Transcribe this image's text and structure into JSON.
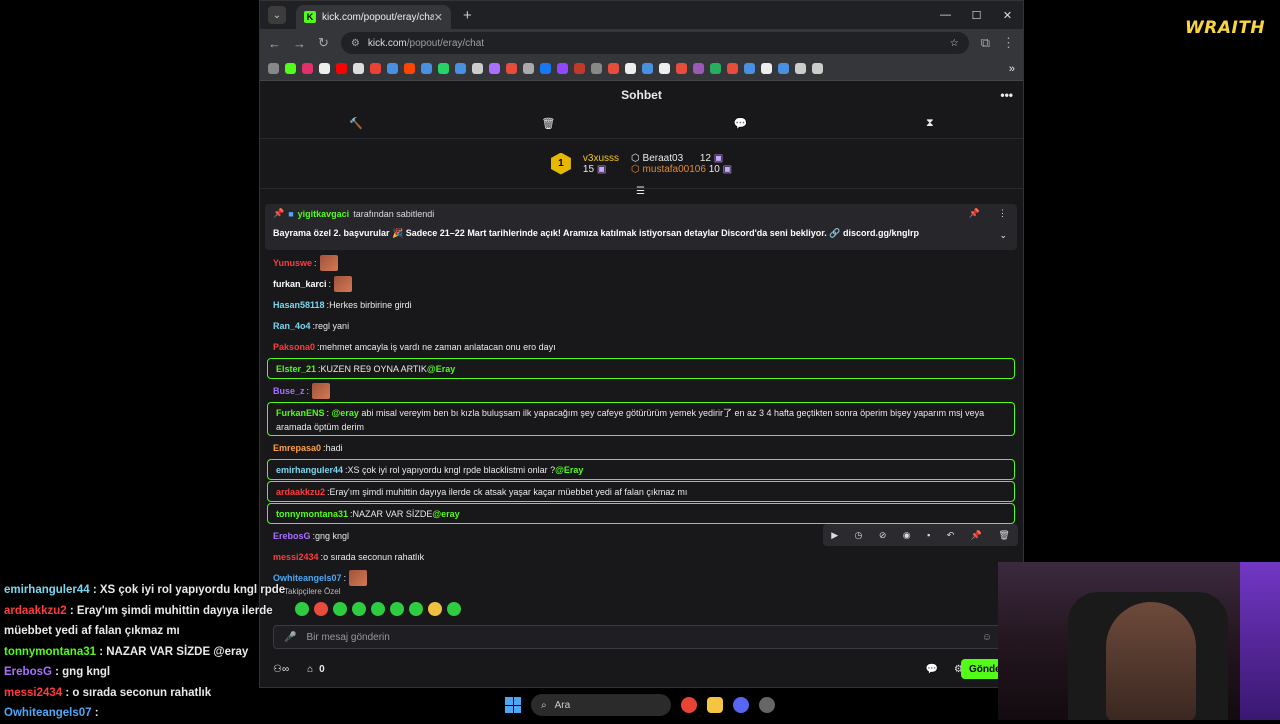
{
  "browser": {
    "tab_title": "kick.com/popout/eray/chat",
    "url_host": "kick.com",
    "url_path": "/popout/eray/chat"
  },
  "chat": {
    "title": "Sohbet",
    "gifters": {
      "first": {
        "rank": "1",
        "name": "v3xusss",
        "count": "15"
      },
      "second": {
        "name": "Beraat03",
        "count": "12"
      },
      "third": {
        "name": "mustafa00106",
        "count": "10"
      }
    },
    "pinned": {
      "by_user": "yigitkavgaci",
      "by_text": "tarafından sabitlendi",
      "message": "Bayrama özel 2. başvurular 🎉 Sadece 21–22 Mart tarihlerinde açık! Aramıza katılmak istiyorsan detaylar Discord'da seni bekliyor. 🔗 discord.gg/knglrp"
    },
    "messages": [
      {
        "name": "Yunuswe",
        "color": "#ff3b3b",
        "text": "",
        "emote": true,
        "hl": false
      },
      {
        "name": "furkan_karci",
        "color": "#ffffff",
        "text": "",
        "emote": true,
        "hl": false
      },
      {
        "name": "Hasan58118",
        "color": "#7ad7f0",
        "text": "Herkes birbirine girdi",
        "emote": false,
        "hl": false
      },
      {
        "name": "Ran_4o4",
        "color": "#7ad7f0",
        "text": "regl yani",
        "emote": false,
        "hl": false
      },
      {
        "name": "Paksona0",
        "color": "#ff3b3b",
        "text": "mehmet amcayla iş vardı ne zaman anlatacan onu ero dayı",
        "emote": false,
        "hl": false
      },
      {
        "name": "Elster_21",
        "color": "#53fc18",
        "text": "KUZEN RE9 OYNA ARTIK",
        "mention": "@Eray",
        "emote": false,
        "hl": true
      },
      {
        "name": "Buse_z",
        "color": "#a970ff",
        "text": "",
        "emote": true,
        "hl": false
      },
      {
        "name": "FurkanENS",
        "color": "#53fc18",
        "text": "abi misal vereyim ben bı kızla buluşsam ilk yapacağım şey cafeye götürürüm yemek yedirir了 en az 3 4 hafta geçtikten sonra öperim bişey yaparım msj veya aramada öptüm derim",
        "mention": "@eray",
        "emote": false,
        "hl": true
      },
      {
        "name": "Emrepasa0",
        "color": "#ff9f43",
        "text": "hadi",
        "emote": false,
        "hl": false
      },
      {
        "name": "emirhanguler44",
        "color": "#7ad7f0",
        "text": "XS çok iyi rol yapıyordu kngl rpde blacklistmi onlar ?",
        "mention": "@Eray",
        "emote": false,
        "hl": true
      },
      {
        "name": "ardaakkzu2",
        "color": "#ff3b3b",
        "text": "Eray'ım şimdi muhittin dayıya ilerde ck atsak yaşar kaçar müebbet yedi af falan çıkmaz mı",
        "emote": false,
        "hl": true
      },
      {
        "name": "tonnymontana31",
        "color": "#53fc18",
        "text": "NAZAR VAR SİZDE",
        "mention": "@eray",
        "emote": false,
        "hl": true
      },
      {
        "name": "ErebosG",
        "color": "#a970ff",
        "text": "gng kngl",
        "emote": false,
        "hl": false
      },
      {
        "name": "messi2434",
        "color": "#ff3b3b",
        "text": "o sırada seconun rahatlık",
        "emote": false,
        "hl": false
      },
      {
        "name": "Owhiteangels07",
        "color": "#4ca7f5",
        "text": "",
        "emote": true,
        "hl": false
      }
    ],
    "followers_label": "Takipçilere Özel",
    "input_placeholder": "Bir mesaj gönderin",
    "points": "0",
    "send_label": "Gönder"
  },
  "overlay": [
    {
      "name": "emirhanguler44",
      "color": "#7ad7f0",
      "text": " : XS çok iyi rol yapıyordu kngl rpde"
    },
    {
      "name": "ardaakkzu2",
      "color": "#ff3b3b",
      "text": " : Eray'ım şimdi muhittin dayıya ilerde"
    },
    {
      "name": "",
      "color": "#fff",
      "text": "müebbet yedi af falan çıkmaz mı"
    },
    {
      "name": "tonnymontana31",
      "color": "#53fc18",
      "text": " : NAZAR VAR SİZDE @eray"
    },
    {
      "name": "ErebosG",
      "color": "#a970ff",
      "text": " : gng kngl"
    },
    {
      "name": "messi2434",
      "color": "#ff3b3b",
      "text": " : o sırada seconun rahatlık"
    },
    {
      "name": "Owhiteangels07",
      "color": "#4ca7f5",
      "text": " :"
    }
  ],
  "logo": "WRAITH",
  "taskbar": {
    "search": "Ara"
  }
}
